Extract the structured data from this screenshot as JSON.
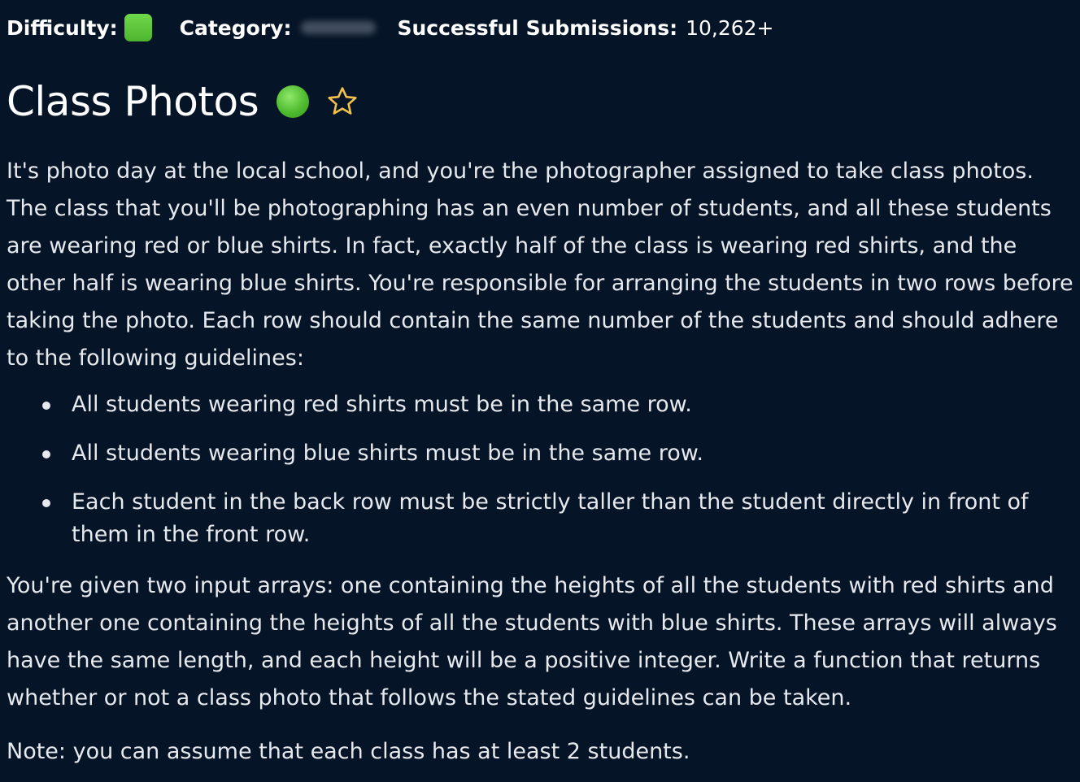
{
  "meta": {
    "difficulty_label": "Difficulty:",
    "category_label": "Category:",
    "submissions_label": "Successful Submissions:",
    "submissions_value": "10,262+"
  },
  "problem": {
    "title": "Class Photos",
    "intro": "It's photo day at the local school, and you're the photographer assigned to take class photos. The class that you'll be photographing has an even number of students, and all these students are wearing red or blue shirts. In fact, exactly half of the class is wearing red shirts, and the other half is wearing blue shirts. You're responsible for arranging the students in two rows before taking the photo. Each row should contain the same number of the students and should adhere to the following guidelines:",
    "rules": [
      "All students wearing red shirts must be in the same row.",
      "All students wearing blue shirts must be in the same row.",
      "Each student in the back row must be strictly taller than the student directly in front of them in the front row."
    ],
    "input_description": "You're given two input arrays: one containing the heights of all the students with red shirts and another one containing the heights of all the students with blue shirts. These arrays will always have the same length, and each height will be a positive integer. Write a function that returns whether or not a class photo that follows the stated guidelines can be taken.",
    "note": "Note: you can assume that each class has at least 2 students."
  },
  "icons": {
    "difficulty": "difficulty-easy-square",
    "status": "solved-status-dot",
    "favorite": "star-outline-icon"
  },
  "colors": {
    "background": "#051426",
    "difficulty_easy": "#5cc93a",
    "star_outline": "#f0c14b"
  }
}
